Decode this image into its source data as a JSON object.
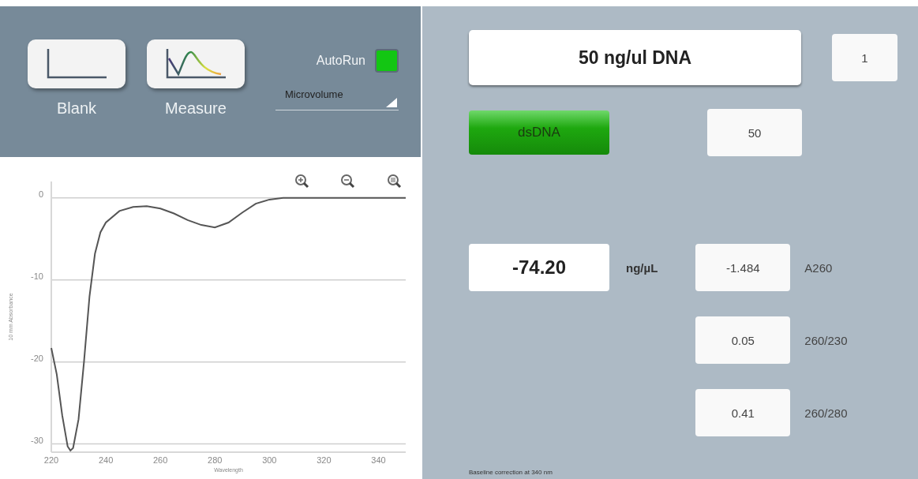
{
  "toolbar": {
    "blank_button": {
      "label": "Blank"
    },
    "measure_button": {
      "label": "Measure"
    },
    "autorun": {
      "label": "AutoRun",
      "checked": true
    },
    "mode_dropdown": {
      "value": "Microvolume"
    }
  },
  "chart": {
    "chart_data": {
      "type": "line",
      "grid": true,
      "xlabel": "Wavelength",
      "ylabel": "10 mm Absorbance",
      "xlim": [
        220,
        350
      ],
      "ylim": [
        -31,
        2
      ],
      "xticks": [
        220,
        240,
        260,
        280,
        300,
        320,
        340
      ],
      "yticks": [
        0,
        -10,
        -20,
        -30
      ],
      "x": [
        220,
        222,
        224,
        226,
        227,
        228,
        230,
        232,
        234,
        236,
        238,
        240,
        245,
        250,
        255,
        260,
        265,
        270,
        275,
        280,
        285,
        290,
        295,
        300,
        305,
        310,
        320,
        330,
        340,
        350
      ],
      "series": [
        {
          "color": "#555555",
          "values": [
            -18.3,
            -21.5,
            -26.5,
            -30.3,
            -30.8,
            -30.5,
            -27,
            -20,
            -12,
            -6.8,
            -4.2,
            -3.0,
            -1.6,
            -1.1,
            -1.0,
            -1.3,
            -1.9,
            -2.7,
            -3.3,
            -3.6,
            -3.0,
            -1.8,
            -0.7,
            -0.2,
            0,
            0,
            0,
            0,
            0,
            0
          ]
        }
      ]
    }
  },
  "sample": {
    "name": "50 ng/ul DNA",
    "number": "1"
  },
  "type_button": {
    "label": "dsDNA",
    "factor": "50"
  },
  "concentration": {
    "value": "-74.20",
    "unit": "ng/µL"
  },
  "readings": [
    {
      "value": "-1.484",
      "label": "A260"
    },
    {
      "value": "0.05",
      "label": "260/230"
    },
    {
      "value": "0.41",
      "label": "260/280"
    }
  ],
  "footer": "Baseline correction at 340 nm"
}
